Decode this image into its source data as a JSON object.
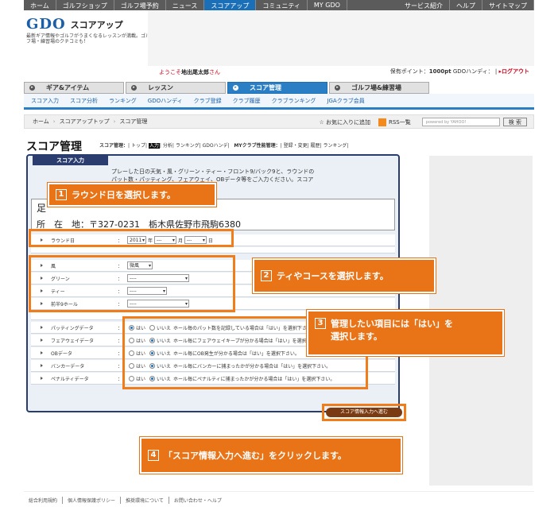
{
  "topnav": {
    "left": [
      "ホーム",
      "ゴルフショップ",
      "ゴルフ場予約",
      "ニュース",
      "スコアアップ",
      "コミュニティ",
      "MY GDO"
    ],
    "active_index": 4,
    "right": [
      "サービス紹介",
      "ヘルプ",
      "サイトマップ"
    ]
  },
  "logo": {
    "brand": "GDO",
    "title": "スコアアップ",
    "tagline": "最新ギア情報やゴルフがうまくなるレッスンが満載。ゴルフ場・練習場のクチコミも！"
  },
  "user": {
    "welcome_prefix": "ようこそ",
    "name": "地出尾太郎",
    "welcome_suffix": "さん",
    "points_label": "保有ポイント：",
    "points_value": "1000pt",
    "handicap_label": "GDOハンディ：",
    "logout": "ログアウト"
  },
  "maintabs": [
    {
      "label": "ギア&アイテム",
      "active": false
    },
    {
      "label": "レッスン",
      "active": false
    },
    {
      "label": "スコア管理",
      "active": true
    },
    {
      "label": "ゴルフ場&練習場",
      "active": false
    }
  ],
  "subnav": [
    "スコア入力",
    "スコア分析",
    "ランキング",
    "GDOハンディ",
    "クラブ登録",
    "クラブ履歴",
    "クラブランキング",
    "JGAクラブ会員"
  ],
  "breadcrumb": {
    "items": [
      "ホーム",
      "スコアアップトップ",
      "スコア管理"
    ],
    "favorite": "お気に入りに追加",
    "rss": "RSS一覧",
    "search_placeholder": "powered by YAHOO!",
    "search_button": "検 索"
  },
  "page": {
    "title": "スコア管理",
    "links_label": "スコア管理：",
    "links": [
      "トップ",
      "入力",
      "分析",
      "ランキング",
      "GDOハンデ"
    ],
    "current_link": "入力",
    "club_label": "MYクラブ性能管理：",
    "club_links": [
      "登録・変更",
      "履歴",
      "ランキング"
    ]
  },
  "panel": {
    "tab": "スコア入力",
    "intro": "プレーした日の天気・風・グリーン・ティー・フロント9/バック9と、ラウンドのパット数・パッティング、フェアウェイ、OBデータ等をご入力ください。スコアカードにある場合には\"は",
    "location_name": "足",
    "location_address": "所　在　地：〒327-0231　栃木県佐野市飛駒6380"
  },
  "form": {
    "round_date": {
      "label": "ラウンド日",
      "year": "2011",
      "year_unit": "年",
      "month": "---",
      "month_unit": "月",
      "day": "---",
      "day_unit": "日"
    },
    "conditions": [
      {
        "label": "風",
        "value": "微風"
      },
      {
        "label": "グリーン",
        "value": "----"
      },
      {
        "label": "ティー",
        "value": "----"
      },
      {
        "label": "前半9ホール",
        "value": "----"
      }
    ],
    "data_rows": [
      {
        "label": "パッティングデータ",
        "yes": "はい",
        "no": "いいえ",
        "selected": "yes",
        "hint": "ホール毎のパット数を記録している場合は「はい」を選択下さい。"
      },
      {
        "label": "フェアウェイデータ",
        "yes": "はい",
        "no": "いいえ",
        "selected": "no",
        "hint": "ホール毎にフェアウェイキープが分かる場合は「はい」を選択下さい。"
      },
      {
        "label": "OBデータ",
        "yes": "はい",
        "no": "いいえ",
        "selected": "no",
        "hint": "ホール毎にOB発生が分かる場合は「はい」を選択下さい。"
      },
      {
        "label": "バンカーデータ",
        "yes": "はい",
        "no": "いいえ",
        "selected": "no",
        "hint": "ホール毎にバンカーに捕まったかが分かる場合は「はい」を選択下さい。"
      },
      {
        "label": "ペナルティデータ",
        "yes": "はい",
        "no": "いいえ",
        "selected": "no",
        "hint": "ホール毎にペナルティに捕まったかが分かる場合は「はい」を選択下さい。"
      }
    ],
    "next_button": "スコア情報入力へ進む"
  },
  "callouts": {
    "c1": {
      "num": "1",
      "text": "ラウンド日を選択します。"
    },
    "c2": {
      "num": "2",
      "text": "ティやコースを選択します。"
    },
    "c3": {
      "num": "3",
      "line1": "管理したい項目には「はい」を",
      "line2": "選択します。"
    },
    "c4": {
      "num": "4",
      "text": "「スコア情報入力へ進む」をクリックします。"
    }
  },
  "footer": [
    "総合利用規約",
    "個人情報保護ポリシー",
    "推奨環境について",
    "お問い合わせ・ヘルプ"
  ],
  "colors": {
    "accent": "#2a7fc4",
    "callout": "#e97418",
    "panel_border": "#283d6f"
  }
}
